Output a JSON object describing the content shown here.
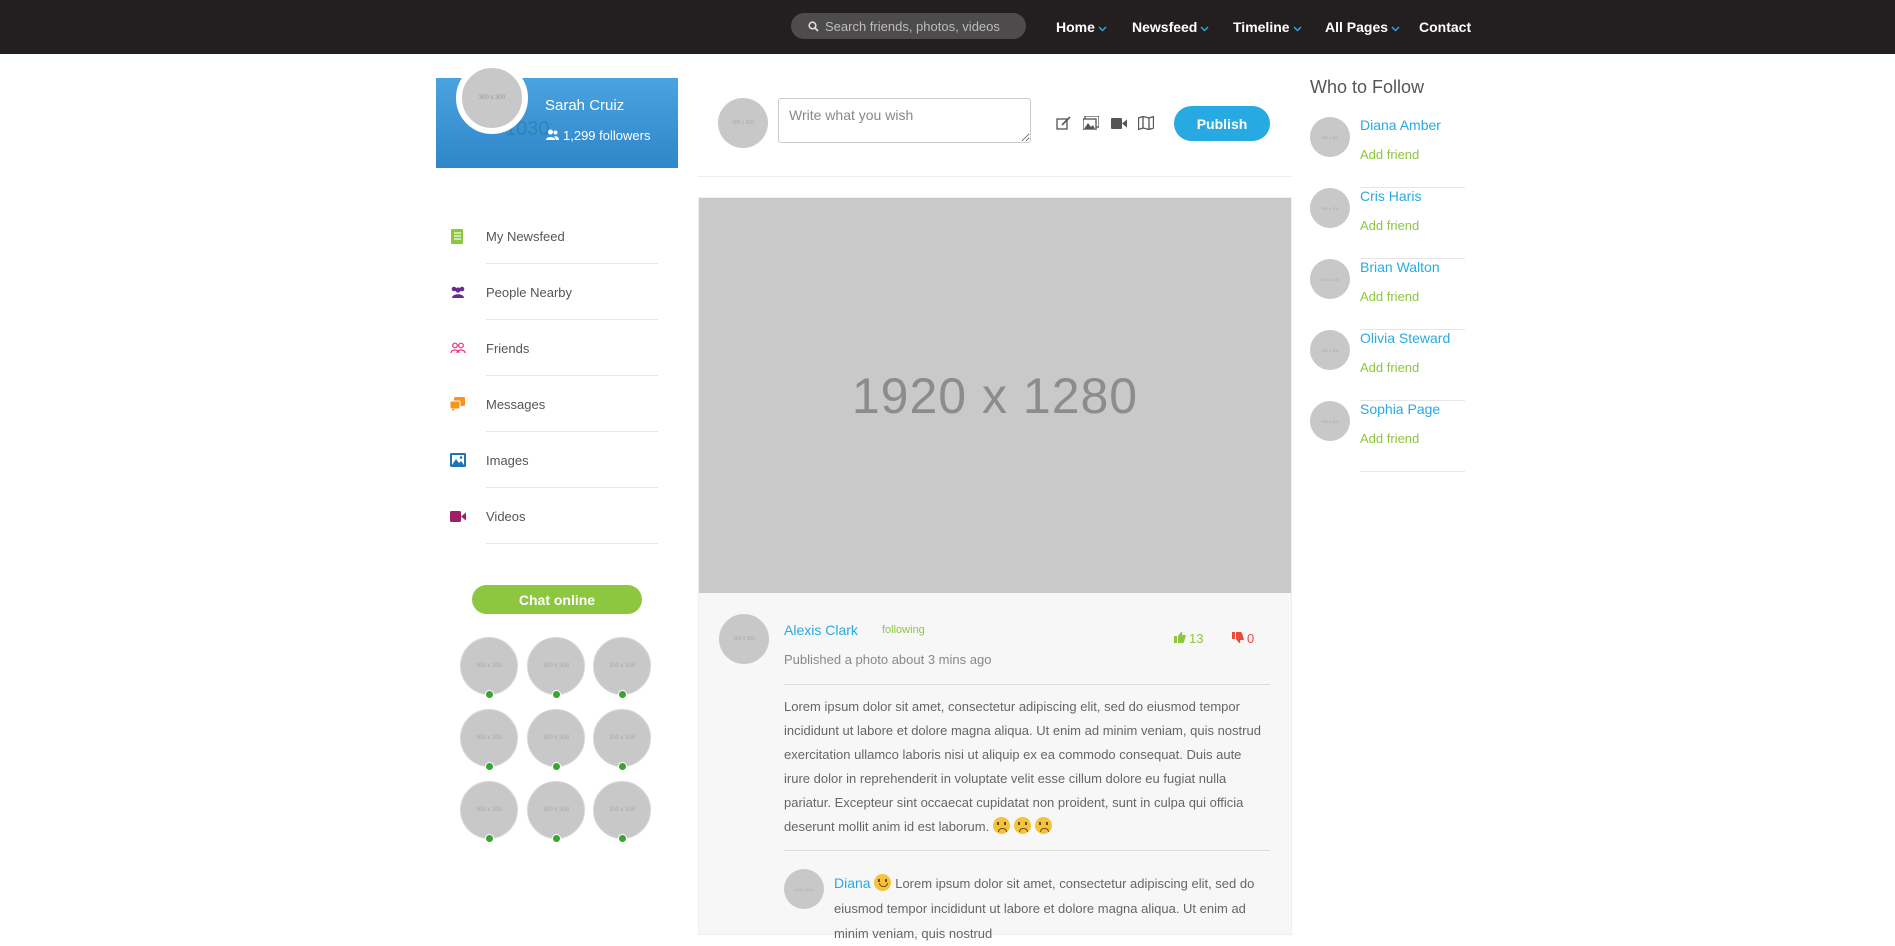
{
  "header": {
    "search_placeholder": "Search friends, photos, videos",
    "nav": [
      {
        "label": "Home",
        "has_dropdown": true
      },
      {
        "label": "Newsfeed",
        "has_dropdown": true
      },
      {
        "label": "Timeline",
        "has_dropdown": true
      },
      {
        "label": "All Pages",
        "has_dropdown": true
      },
      {
        "label": "Contact",
        "has_dropdown": false
      }
    ]
  },
  "profile": {
    "name": "Sarah Cruiz",
    "followers": "1,299 followers",
    "avatar_placeholder": "300 x 300",
    "ghost_number": "1030"
  },
  "sidebar": {
    "items": [
      {
        "label": "My Newsfeed",
        "icon": "newsfeed-icon",
        "color": "#8dc63f"
      },
      {
        "label": "People Nearby",
        "icon": "people-nearby-icon",
        "color": "#662d91"
      },
      {
        "label": "Friends",
        "icon": "friends-icon",
        "color": "#ee2a7b"
      },
      {
        "label": "Messages",
        "icon": "messages-icon",
        "color": "#f7941d"
      },
      {
        "label": "Images",
        "icon": "images-icon",
        "color": "#1c75bc"
      },
      {
        "label": "Videos",
        "icon": "videos-icon",
        "color": "#9e1f63"
      }
    ],
    "chat_label": "Chat online",
    "chat_avatar_placeholder": "300 x 300"
  },
  "composer": {
    "placeholder": "Write what you wish",
    "publish_label": "Publish",
    "avatar_placeholder": "300 x 300"
  },
  "post": {
    "image_label": "1920 x 1280",
    "author": "Alexis Clark",
    "following_label": "following",
    "meta": "Published a photo about 3 mins ago",
    "likes": "13",
    "dislikes": "0",
    "text": "Lorem ipsum dolor sit amet, consectetur adipiscing elit, sed do eiusmod tempor incididunt ut labore et dolore magna aliqua. Ut enim ad minim veniam, quis nostrud exercitation ullamco laboris nisi ut aliquip ex ea commodo consequat. Duis aute irure dolor in reprehenderit in voluptate velit esse cillum dolore eu fugiat nulla pariatur. Excepteur sint occaecat cupidatat non proident, sunt in culpa qui officia deserunt mollit anim id est laborum.",
    "comment_author": "Diana",
    "comment_text": "Lorem ipsum dolor sit amet, consectetur adipiscing elit, sed do eiusmod tempor incididunt ut labore et dolore magna aliqua. Ut enim ad minim veniam, quis nostrud",
    "avatar_placeholder": "300 x 300"
  },
  "who_to_follow": {
    "title": "Who to Follow",
    "add_label": "Add friend",
    "avatar_placeholder": "300 x 300",
    "people": [
      "Diana Amber",
      "Cris Haris",
      "Brian Walton",
      "Olivia Steward",
      "Sophia Page"
    ]
  },
  "colors": {
    "accent_blue": "#27aae1",
    "accent_green": "#8dc63f",
    "header_bg": "#231f20",
    "online_dot": "#36a532",
    "dislike_red": "#e74c3c"
  }
}
